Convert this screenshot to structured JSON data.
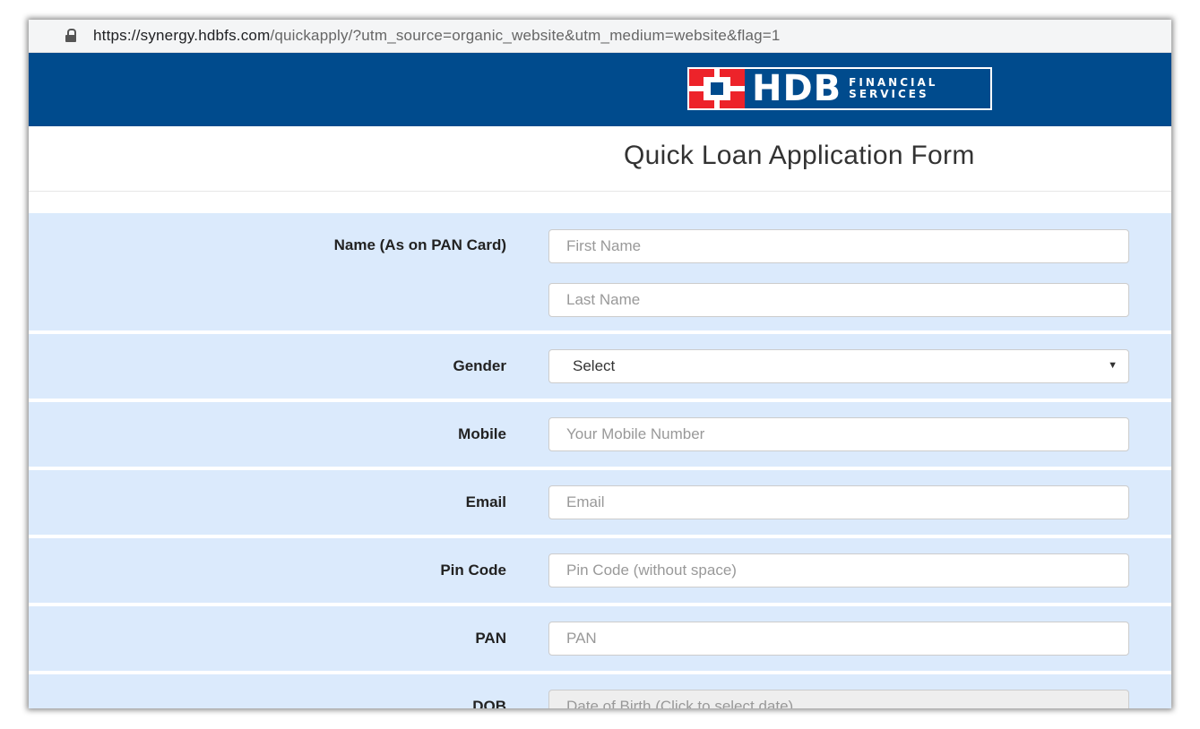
{
  "browser": {
    "url_host": "https://synergy.hdbfs.com",
    "url_path": "/quickapply/?utm_source=organic_website&utm_medium=website&flag=1"
  },
  "header": {
    "logo_text": "HDB",
    "logo_sub_line1": "FINANCIAL",
    "logo_sub_line2": "SERVICES",
    "brand_color": "#004b8d",
    "logo_red": "#ed232a"
  },
  "page": {
    "title": "Quick Loan Application Form"
  },
  "form": {
    "name_label": "Name (As on PAN Card)",
    "first_name_placeholder": "First Name",
    "last_name_placeholder": "Last Name",
    "gender_label": "Gender",
    "gender_value": "Select",
    "mobile_label": "Mobile",
    "mobile_placeholder": "Your Mobile Number",
    "email_label": "Email",
    "email_placeholder": "Email",
    "pincode_label": "Pin Code",
    "pincode_placeholder": "Pin Code (without space)",
    "pan_label": "PAN",
    "pan_placeholder": "PAN",
    "dob_label": "DOB",
    "dob_placeholder": "Date of Birth (Click to select date)",
    "row_color": "#dbeafc"
  }
}
